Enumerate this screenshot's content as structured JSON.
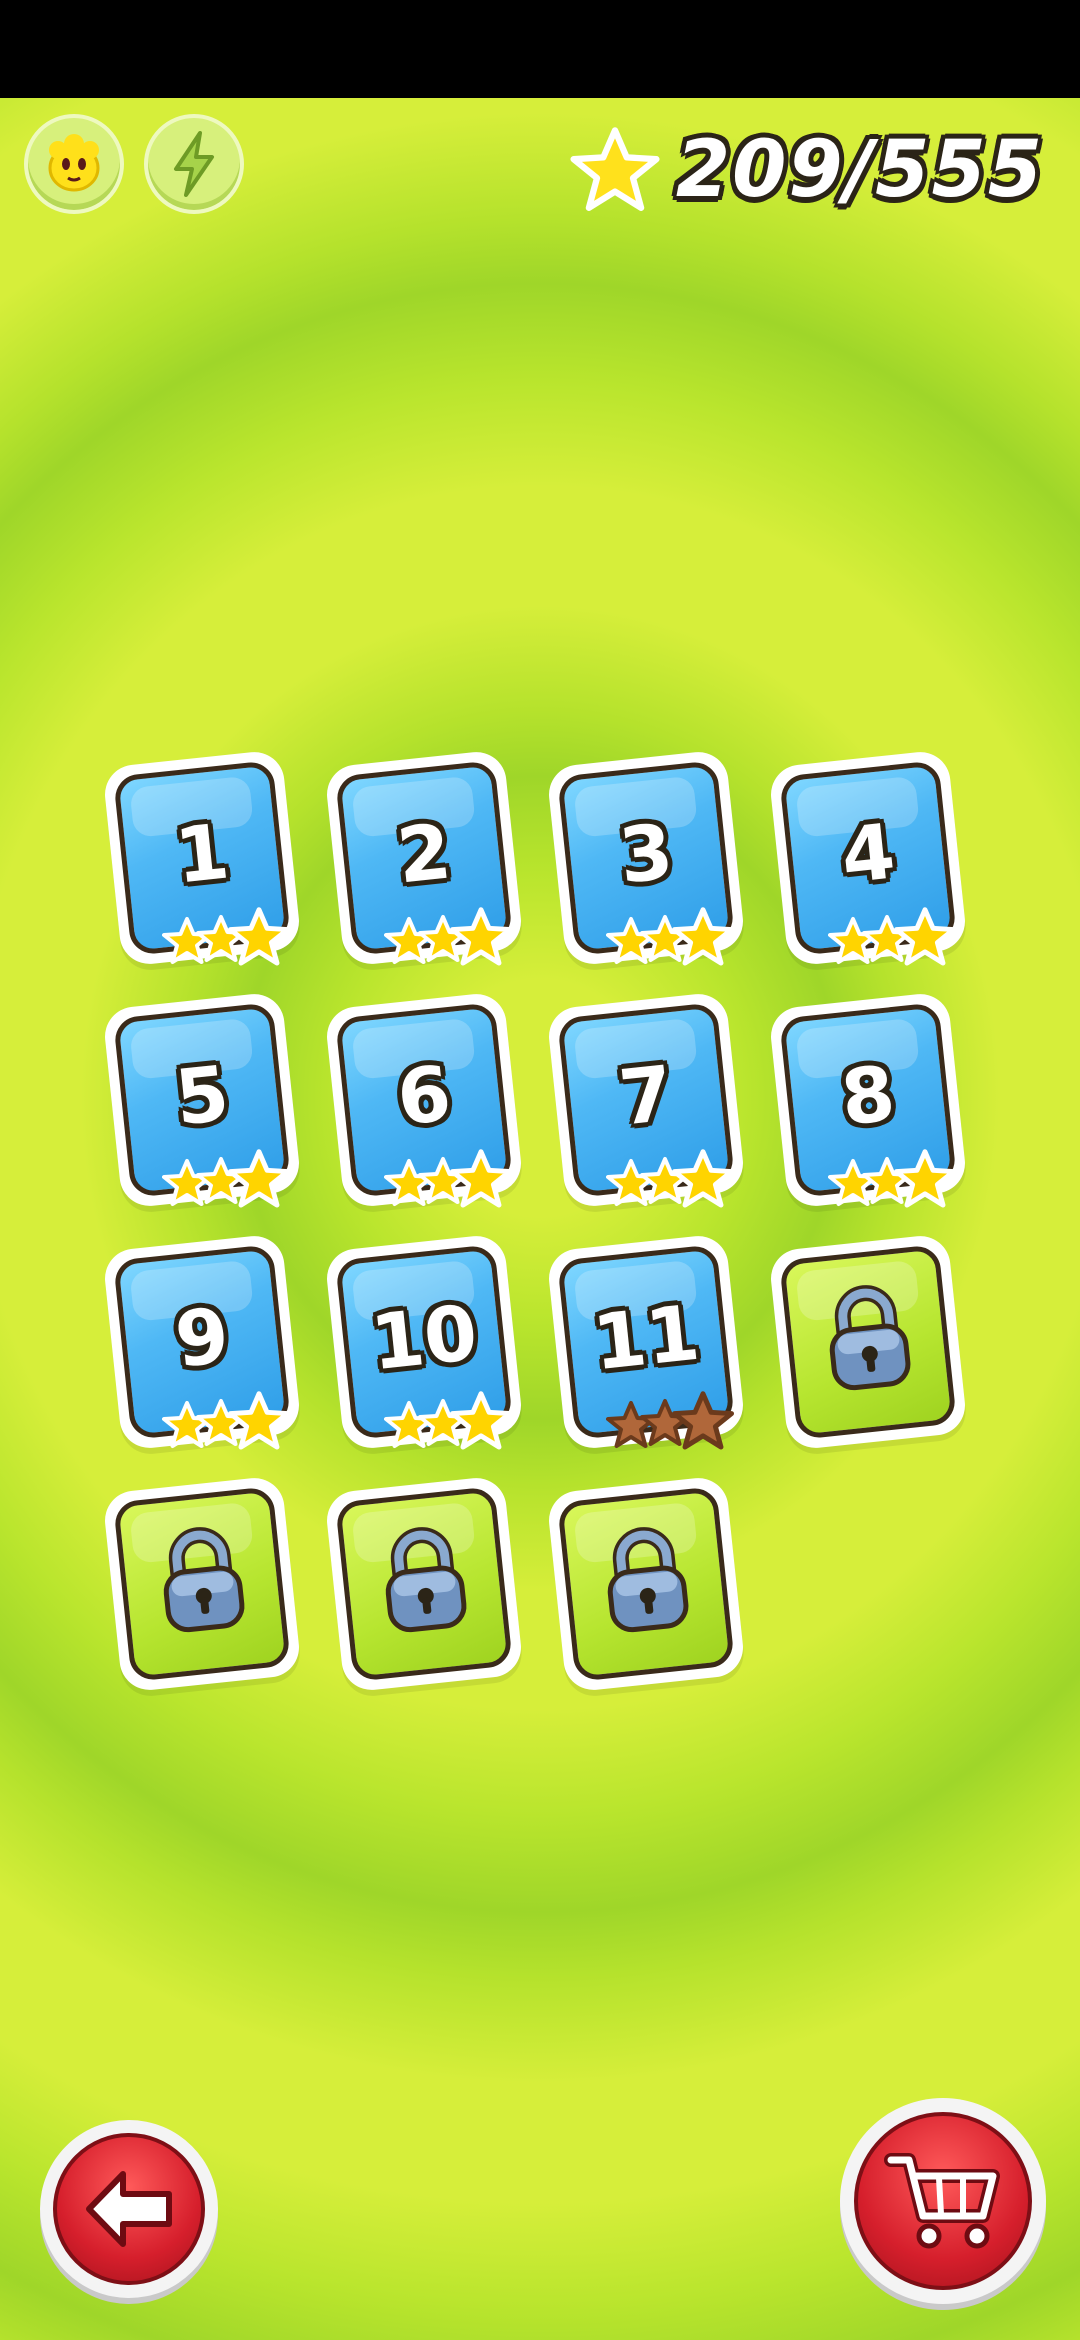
{
  "hud": {
    "character_icon": "character-icon",
    "power_icon": "lightning-icon",
    "star_icon": "star-icon",
    "stars_collected": "209/555"
  },
  "levels": [
    {
      "number": "1",
      "unlocked": true,
      "stars": 3,
      "star_color": "gold"
    },
    {
      "number": "2",
      "unlocked": true,
      "stars": 3,
      "star_color": "gold"
    },
    {
      "number": "3",
      "unlocked": true,
      "stars": 3,
      "star_color": "gold"
    },
    {
      "number": "4",
      "unlocked": true,
      "stars": 3,
      "star_color": "gold"
    },
    {
      "number": "5",
      "unlocked": true,
      "stars": 3,
      "star_color": "gold"
    },
    {
      "number": "6",
      "unlocked": true,
      "stars": 3,
      "star_color": "gold"
    },
    {
      "number": "7",
      "unlocked": true,
      "stars": 3,
      "star_color": "gold"
    },
    {
      "number": "8",
      "unlocked": true,
      "stars": 3,
      "star_color": "gold"
    },
    {
      "number": "9",
      "unlocked": true,
      "stars": 3,
      "star_color": "gold"
    },
    {
      "number": "10",
      "unlocked": true,
      "stars": 3,
      "star_color": "gold"
    },
    {
      "number": "11",
      "unlocked": true,
      "stars": 3,
      "star_color": "bronze"
    },
    {
      "number": "",
      "unlocked": false
    },
    {
      "number": "",
      "unlocked": false
    },
    {
      "number": "",
      "unlocked": false
    },
    {
      "number": "",
      "unlocked": false
    }
  ],
  "buttons": {
    "back_icon": "arrow-left-icon",
    "shop_icon": "shopping-cart-icon"
  },
  "colors": {
    "card_blue": "#2f9ee8",
    "card_locked": "#b6e52f",
    "star_gold": "#ffd400",
    "star_bronze": "#b0673a",
    "button_red": "#d61f2c"
  }
}
